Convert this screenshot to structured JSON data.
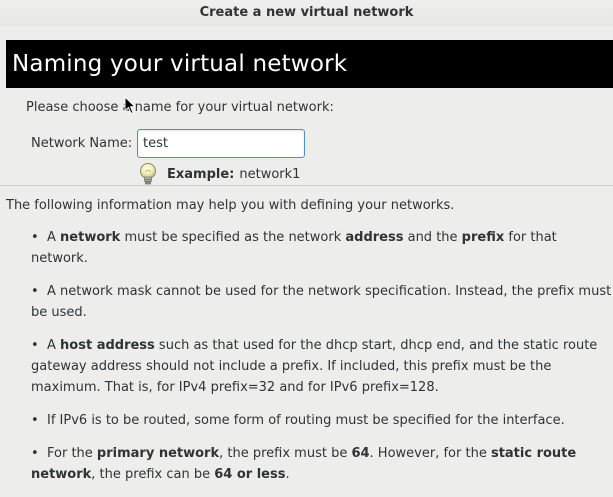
{
  "window": {
    "title": "Create a new virtual network"
  },
  "header": {
    "title": "Naming your virtual network"
  },
  "form": {
    "prompt": "Please choose a name for your virtual network:",
    "name_label": "Network Name:",
    "name_value": "test",
    "example_label": "Example:",
    "example_value": "network1",
    "example_icon": "lightbulb-icon"
  },
  "info": {
    "intro": "The following information may help you with defining your networks.",
    "bullet_glyph": "•",
    "b1": {
      "p1": "A ",
      "k1": "network",
      "p2": " must be specified as the network ",
      "k2": "address",
      "p3": " and the ",
      "k3": "prefix",
      "p4": " for that network."
    },
    "b2": {
      "text": "A network mask cannot be used for the network specification.  Instead, the prefix must be used."
    },
    "b3": {
      "p1": "A ",
      "k1": "host address",
      "p2": " such as that used for the dhcp start, dhcp end, and the static route gateway address should not include a prefix.  If included, this prefix must be the maximum.  That is, for IPv4 prefix=32 and for IPv6 prefix=128."
    },
    "b4": {
      "text": "If IPv6 is to be routed, some form of routing must be specified for the interface."
    },
    "b5": {
      "p1": "For the ",
      "k1": "primary network",
      "p2": ", the prefix must be ",
      "k2": "64",
      "p3": ".  However, for the ",
      "k3": "static route network",
      "p4": ", the prefix can be ",
      "k4": "64 or less",
      "p5": "."
    }
  },
  "colors": {
    "header_bg": "#000000",
    "header_text": "#ffffff",
    "window_bg": "#ededec",
    "input_focus_border": "#4a90d9"
  }
}
